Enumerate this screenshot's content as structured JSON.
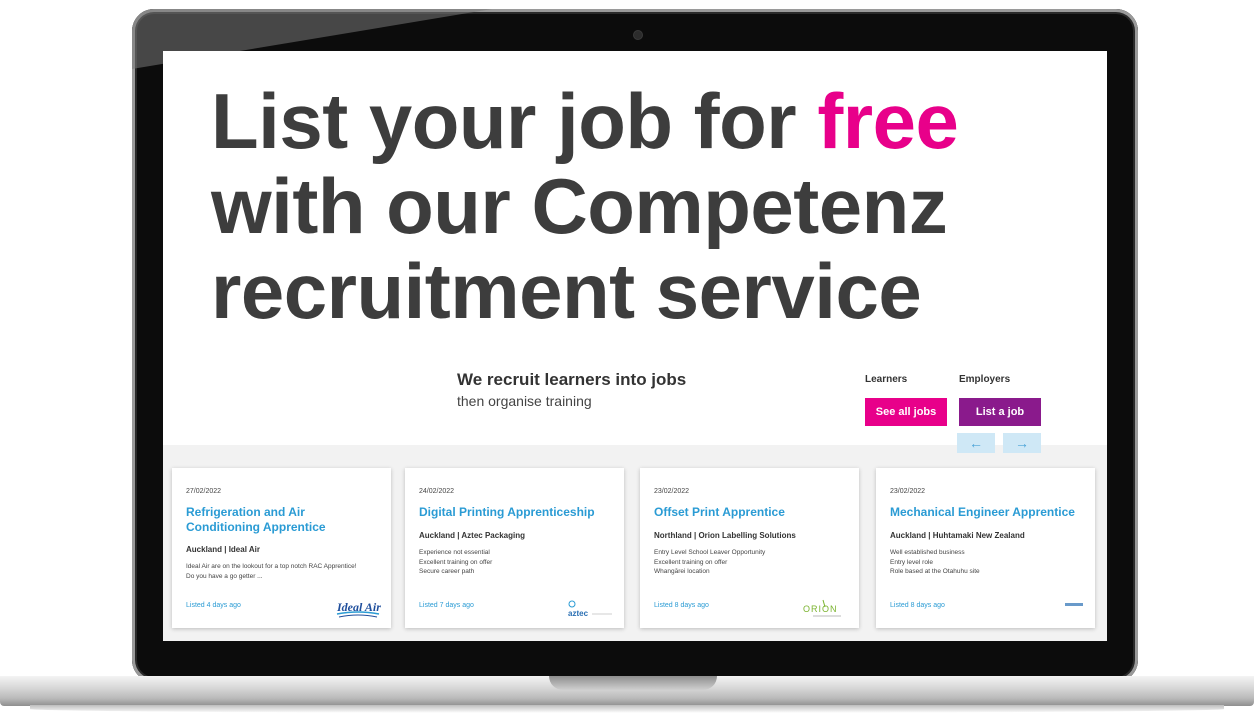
{
  "hero": {
    "line1_prefix": "List your job for ",
    "line1_accent": "free",
    "line2": "with our Competenz",
    "line3": "recruitment service"
  },
  "intro": {
    "title": "We recruit learners into jobs",
    "subtitle": "then organise training"
  },
  "learners": {
    "label": "Learners",
    "button": "See all jobs"
  },
  "employers": {
    "label": "Employers",
    "button": "List a job"
  },
  "nav": {
    "prev": "←",
    "next": "→"
  },
  "colors": {
    "accent_pink": "#e8008a",
    "accent_purple": "#8a1a8c",
    "link_blue": "#2a9bd4"
  },
  "jobs": [
    {
      "date": "27/02/2022",
      "title": "Refrigeration and Air Conditioning Apprentice",
      "location": "Auckland | Ideal Air",
      "description": [
        "Ideal Air are on the lookout for a top notch RAC Apprentice!",
        "Do you have a go getter ..."
      ],
      "listed": "Listed 4 days ago",
      "logo": "Ideal Air"
    },
    {
      "date": "24/02/2022",
      "title": "Digital Printing Apprenticeship",
      "location": "Auckland | Aztec Packaging",
      "description": [
        "Experience not essential",
        "Excellent training on offer",
        "Secure career path"
      ],
      "listed": "Listed 7 days ago",
      "logo": "aztec"
    },
    {
      "date": "23/02/2022",
      "title": "Offset Print Apprentice",
      "location": "Northland | Orion Labelling Solutions",
      "description": [
        "Entry Level School Leaver Opportunity",
        "Excellent training on offer",
        "Whangārei location"
      ],
      "listed": "Listed 8 days ago",
      "logo": "ORION"
    },
    {
      "date": "23/02/2022",
      "title": "Mechanical Engineer Apprentice",
      "location": "Auckland | Huhtamaki New Zealand",
      "description": [
        "Well established business",
        "Entry level role",
        "Role based at the Otahuhu site"
      ],
      "listed": "Listed 8 days ago",
      "logo": ""
    }
  ]
}
